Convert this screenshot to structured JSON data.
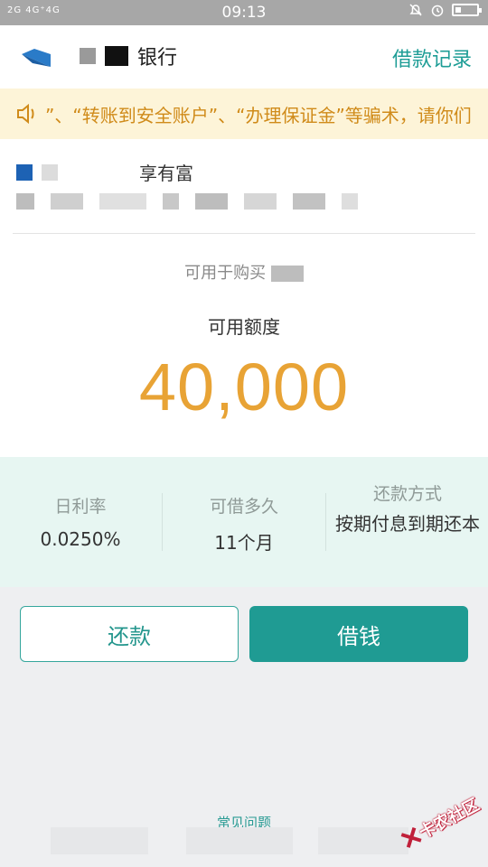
{
  "statusbar": {
    "time": "09:13",
    "signal_text": "2G 4G⁺4G",
    "icons": [
      "silent-icon",
      "alarm-icon",
      "battery-icon"
    ]
  },
  "header": {
    "title_visible": "银行",
    "record_link": "借款记录",
    "back_icon": "back-arrow-icon"
  },
  "notice": {
    "icon": "speaker-icon",
    "text": "”、“转账到安全账户”、“办理保证金”等骗术，请你们"
  },
  "product": {
    "name_visible": "享有富"
  },
  "quota": {
    "usage_visible": "可用于购买",
    "label": "可用额度",
    "value": "40,000"
  },
  "stats": [
    {
      "label": "日利率",
      "value": "0.0250%"
    },
    {
      "label": "可借多久",
      "value": "11个月"
    },
    {
      "label": "还款方式",
      "value": "按期付息到期还本"
    }
  ],
  "actions": {
    "repay": "还款",
    "borrow": "借钱"
  },
  "footer": {
    "faq": "常见问题"
  },
  "watermark": {
    "text": "卡农社区"
  },
  "colors": {
    "accent": "#1f9b93",
    "quota": "#e8a335",
    "notice_text": "#d08b1a",
    "notice_bg": "#fdf4d8",
    "stats_bg": "#e7f6f2"
  }
}
